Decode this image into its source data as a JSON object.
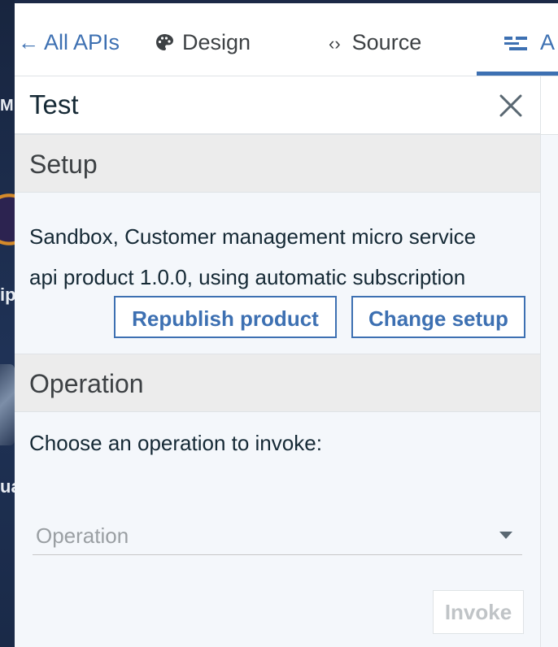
{
  "nav": {
    "back": "All APIs",
    "design": "Design",
    "source": "Source",
    "assemble_partial": "A"
  },
  "desktop": {
    "labels": [
      "M",
      "ip",
      "ua"
    ]
  },
  "panel": {
    "title": "Test",
    "setup": {
      "heading": "Setup",
      "description_line1": "Sandbox, Customer management micro service",
      "description_line2": "api product 1.0.0, using automatic subscription",
      "republish_label": "Republish product",
      "change_setup_label": "Change setup"
    },
    "operation": {
      "heading": "Operation",
      "prompt": "Choose an operation to invoke:",
      "select_placeholder": "Operation",
      "invoke_label": "Invoke"
    }
  },
  "colors": {
    "accent": "#3d70b2",
    "section_bg": "#ececec",
    "panel_bg": "#f4f7fb",
    "text": "#152935"
  }
}
